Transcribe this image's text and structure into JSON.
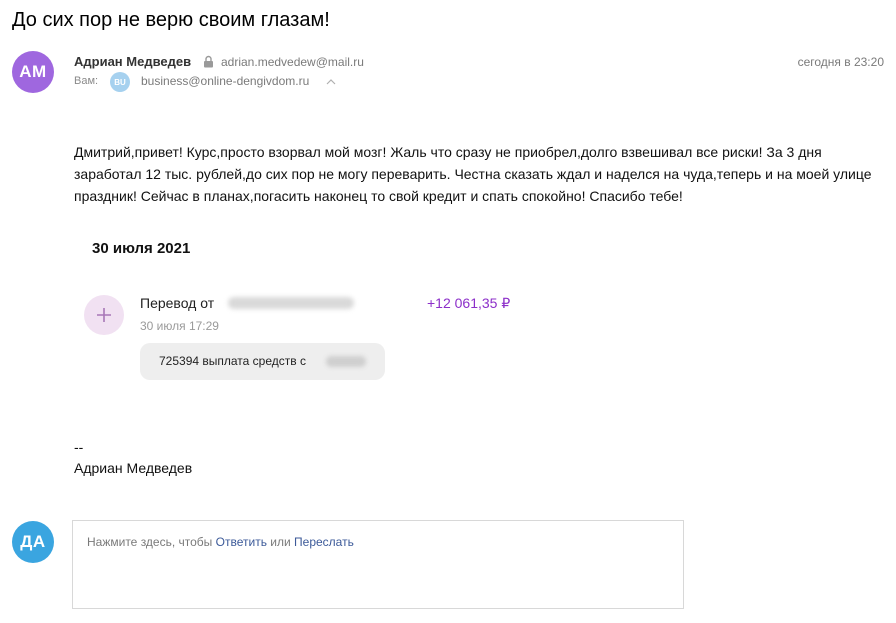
{
  "subject": "До сих пор не верю своим глазам!",
  "sender": {
    "initials": "АМ",
    "name": "Адриан Медведев",
    "email": "adrian.medvedew@mail.ru",
    "date": "сегодня в 23:20",
    "avatar_color": "#9f67df"
  },
  "recipient": {
    "label": "Вам:",
    "initials": "BU",
    "email": "business@online-dengivdom.ru"
  },
  "body": {
    "text": "Дмитрий,привет! Курс,просто взорвал мой мозг! Жаль что сразу не приобрел,долго взвешивал все риски! За 3 дня заработал 12 тыс. рублей,до сих пор не могу переварить. Честна сказать ждал и наделся на чуда,теперь и на моей улице праздник! Сейчас в планах,погасить наконец то свой кредит и спать спокойно! Спасибо тебе!"
  },
  "receipt": {
    "date": "30 июля 2021",
    "title": "Перевод от",
    "amount": "+12 061,35 ₽",
    "time": "30 июля 17:29",
    "message": "725394 выплата средств с",
    "icon": "plus-icon"
  },
  "signature": {
    "dash": "--",
    "name": "Адриан Медведев"
  },
  "reply": {
    "my_initials": "ДА",
    "my_avatar_color": "#3aa5e0",
    "prompt_before": "Нажмите здесь, чтобы ",
    "reply_link": "Ответить",
    "or": " или ",
    "forward_link": "Переслать"
  }
}
